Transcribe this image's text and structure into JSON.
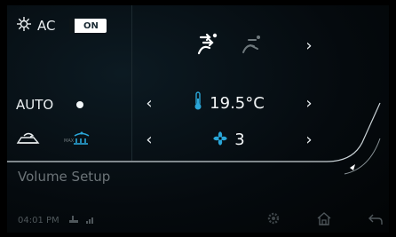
{
  "climate": {
    "ac_label": "AC",
    "ac_state": "ON",
    "auto_label": "AUTO",
    "temperature": "19.5°C",
    "fan_speed": "3"
  },
  "footer": {
    "volume_setup": "Volume Setup",
    "clock": "04:01 PM"
  },
  "icons": {
    "ac": "snowflake-gear-icon",
    "airflow_face": "airflow-face-icon",
    "airflow_feet": "airflow-feet-icon",
    "recirculation": "car-recirculation-icon",
    "max_defrost": "max-defrost-icon",
    "temperature": "thermometer-icon",
    "fan": "fan-icon",
    "settings": "gear-icon",
    "home": "home-icon",
    "back": "back-arrow-icon"
  },
  "colors": {
    "accent": "#2aa6d8",
    "active_icon": "#ffffff",
    "dim_icon": "#6e787c"
  }
}
